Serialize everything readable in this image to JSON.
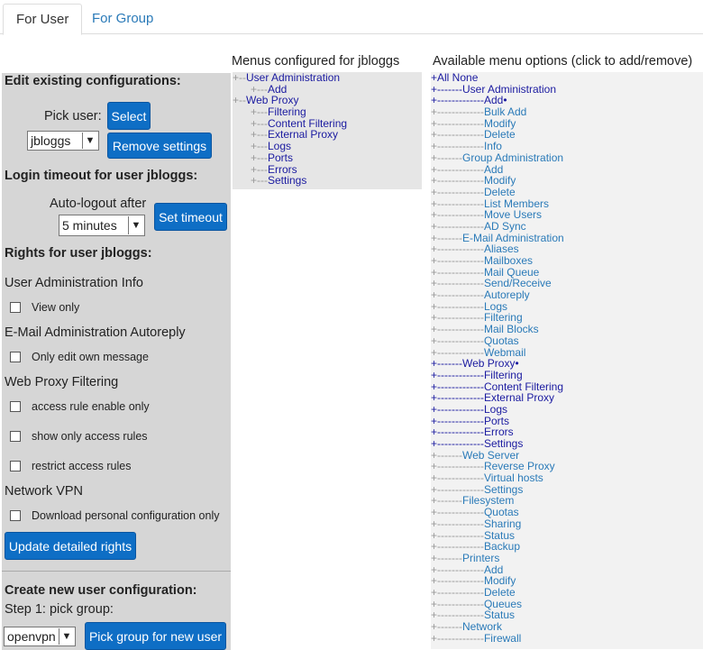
{
  "tabs": [
    "For User",
    "For Group"
  ],
  "left": {
    "edit_header": "Edit existing configurations:",
    "pick_user_label": "Pick user:",
    "select_button": "Select",
    "user_value": "jbloggs",
    "remove_button": "Remove settings",
    "timeout_header": "Login timeout for user jbloggs:",
    "autologout_label": "Auto-logout after",
    "timeout_value": "5 minutes",
    "set_timeout_button": "Set timeout",
    "rights_header": "Rights for user jbloggs:",
    "sections": [
      {
        "title": "User Administration Info",
        "options": [
          "View only"
        ]
      },
      {
        "title": "E-Mail Administration Autoreply",
        "options": [
          "Only edit own message"
        ]
      },
      {
        "title": "Web Proxy Filtering",
        "options": [
          "access rule enable only",
          "show only access rules",
          "restrict access rules"
        ]
      },
      {
        "title": "Network VPN",
        "options": [
          "Download personal configuration only"
        ]
      }
    ],
    "update_button": "Update detailed rights",
    "create_header": "Create new user configuration:",
    "step1_label": "Step 1: pick group:",
    "group_value": "openvpn",
    "pick_group_button": "Pick group for new user"
  },
  "middle": {
    "header": "Menus configured for jbloggs",
    "items": [
      {
        "prefix": "+--",
        "label": "User Administration"
      },
      {
        "prefix": "      +---",
        "label": "Add"
      },
      {
        "prefix": "+--",
        "label": "Web Proxy"
      },
      {
        "prefix": "      +---",
        "label": "Filtering"
      },
      {
        "prefix": "      +---",
        "label": "Content Filtering"
      },
      {
        "prefix": "      +---",
        "label": "External Proxy"
      },
      {
        "prefix": "      +---",
        "label": "Logs"
      },
      {
        "prefix": "      +---",
        "label": "Ports"
      },
      {
        "prefix": "      +---",
        "label": "Errors"
      },
      {
        "prefix": "      +---",
        "label": "Settings"
      }
    ]
  },
  "right": {
    "header": "Available menu options (click to add/remove)",
    "items": [
      {
        "prefix": "+",
        "label": "All None",
        "dark": true
      },
      {
        "prefix": "+-------",
        "label": "User Administration",
        "dark": true
      },
      {
        "prefix": "+-------------",
        "label": "Add•",
        "dark": true
      },
      {
        "prefix": "+-------------",
        "label": "Bulk Add",
        "dark": false
      },
      {
        "prefix": "+-------------",
        "label": "Modify",
        "dark": false
      },
      {
        "prefix": "+-------------",
        "label": "Delete",
        "dark": false
      },
      {
        "prefix": "+-------------",
        "label": "Info",
        "dark": false
      },
      {
        "prefix": "+-------",
        "label": "Group Administration",
        "dark": false
      },
      {
        "prefix": "+-------------",
        "label": "Add",
        "dark": false
      },
      {
        "prefix": "+-------------",
        "label": "Modify",
        "dark": false
      },
      {
        "prefix": "+-------------",
        "label": "Delete",
        "dark": false
      },
      {
        "prefix": "+-------------",
        "label": "List Members",
        "dark": false
      },
      {
        "prefix": "+-------------",
        "label": "Move Users",
        "dark": false
      },
      {
        "prefix": "+-------------",
        "label": "AD Sync",
        "dark": false
      },
      {
        "prefix": "+-------",
        "label": "E-Mail Administration",
        "dark": false
      },
      {
        "prefix": "+-------------",
        "label": "Aliases",
        "dark": false
      },
      {
        "prefix": "+-------------",
        "label": "Mailboxes",
        "dark": false
      },
      {
        "prefix": "+-------------",
        "label": "Mail Queue",
        "dark": false
      },
      {
        "prefix": "+-------------",
        "label": "Send/Receive",
        "dark": false
      },
      {
        "prefix": "+-------------",
        "label": "Autoreply",
        "dark": false
      },
      {
        "prefix": "+-------------",
        "label": "Logs",
        "dark": false
      },
      {
        "prefix": "+-------------",
        "label": "Filtering",
        "dark": false
      },
      {
        "prefix": "+-------------",
        "label": "Mail Blocks",
        "dark": false
      },
      {
        "prefix": "+-------------",
        "label": "Quotas",
        "dark": false
      },
      {
        "prefix": "+-------------",
        "label": "Webmail",
        "dark": false
      },
      {
        "prefix": "+-------",
        "label": "Web Proxy•",
        "dark": true
      },
      {
        "prefix": "+-------------",
        "label": "Filtering",
        "dark": true
      },
      {
        "prefix": "+-------------",
        "label": "Content Filtering",
        "dark": true
      },
      {
        "prefix": "+-------------",
        "label": "External Proxy",
        "dark": true
      },
      {
        "prefix": "+-------------",
        "label": "Logs",
        "dark": true
      },
      {
        "prefix": "+-------------",
        "label": "Ports",
        "dark": true
      },
      {
        "prefix": "+-------------",
        "label": "Errors",
        "dark": true
      },
      {
        "prefix": "+-------------",
        "label": "Settings",
        "dark": true
      },
      {
        "prefix": "+-------",
        "label": "Web Server",
        "dark": false
      },
      {
        "prefix": "+-------------",
        "label": "Reverse Proxy",
        "dark": false
      },
      {
        "prefix": "+-------------",
        "label": "Virtual hosts",
        "dark": false
      },
      {
        "prefix": "+-------------",
        "label": "Settings",
        "dark": false
      },
      {
        "prefix": "+-------",
        "label": "Filesystem",
        "dark": false
      },
      {
        "prefix": "+-------------",
        "label": "Quotas",
        "dark": false
      },
      {
        "prefix": "+-------------",
        "label": "Sharing",
        "dark": false
      },
      {
        "prefix": "+-------------",
        "label": "Status",
        "dark": false
      },
      {
        "prefix": "+-------------",
        "label": "Backup",
        "dark": false
      },
      {
        "prefix": "+-------",
        "label": "Printers",
        "dark": false
      },
      {
        "prefix": "+-------------",
        "label": "Add",
        "dark": false
      },
      {
        "prefix": "+-------------",
        "label": "Modify",
        "dark": false
      },
      {
        "prefix": "+-------------",
        "label": "Delete",
        "dark": false
      },
      {
        "prefix": "+-------------",
        "label": "Queues",
        "dark": false
      },
      {
        "prefix": "+-------------",
        "label": "Status",
        "dark": false
      },
      {
        "prefix": "+-------",
        "label": "Network",
        "dark": false
      },
      {
        "prefix": "+-------------",
        "label": "Firewall",
        "dark": false
      }
    ]
  },
  "colors": {
    "button": "#0e6ec5",
    "link_dark": "#1a1aa0",
    "link": "#2a7ab8",
    "panel": "#d6d6d6"
  }
}
